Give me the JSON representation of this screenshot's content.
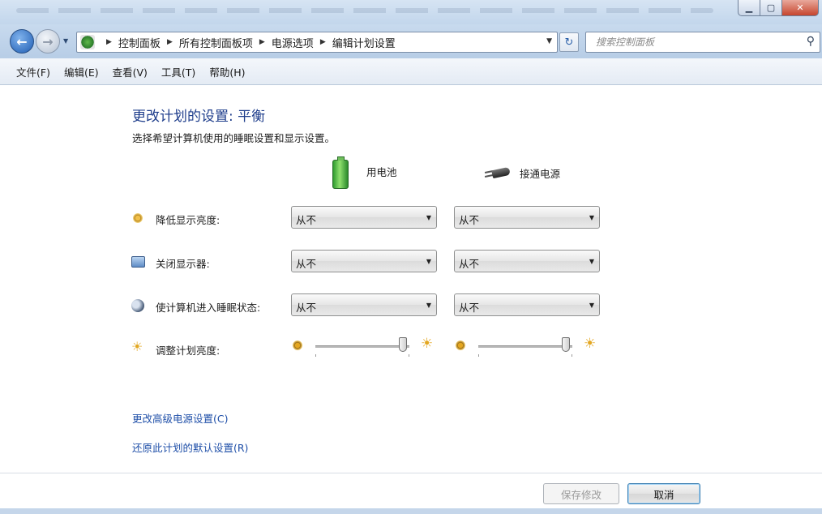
{
  "window": {
    "minimize_icon": "minimize-icon",
    "maximize_icon": "maximize-icon",
    "close_icon": "close-icon"
  },
  "nav": {
    "back_icon": "back-arrow-icon",
    "forward_icon": "forward-arrow-icon",
    "breadcrumbs": [
      "控制面板",
      "所有控制面板项",
      "电源选项",
      "编辑计划设置"
    ],
    "search_placeholder": "搜索控制面板"
  },
  "menu": {
    "items": [
      "文件(F)",
      "编辑(E)",
      "查看(V)",
      "工具(T)",
      "帮助(H)"
    ]
  },
  "main": {
    "title": "更改计划的设置: 平衡",
    "subtitle": "选择希望计算机使用的睡眠设置和显示设置。",
    "columns": {
      "battery": "用电池",
      "plugged": "接通电源"
    },
    "settings": [
      {
        "label": "降低显示亮度:",
        "battery": "从不",
        "plugged": "从不",
        "icon": "dim-display-icon"
      },
      {
        "label": "关闭显示器:",
        "battery": "从不",
        "plugged": "从不",
        "icon": "monitor-icon"
      },
      {
        "label": "使计算机进入睡眠状态:",
        "battery": "从不",
        "plugged": "从不",
        "icon": "sleep-icon"
      }
    ],
    "brightness": {
      "label": "调整计划亮度:",
      "battery_level": 0.93,
      "plugged_level": 0.93
    },
    "links": {
      "advanced": "更改高级电源设置(C)",
      "restore": "还原此计划的默认设置(R)"
    }
  },
  "footer": {
    "save": "保存修改",
    "cancel": "取消"
  },
  "colors": {
    "title": "#1f3e8c",
    "link": "#1f4fa8",
    "chrome": "#c8daee"
  }
}
